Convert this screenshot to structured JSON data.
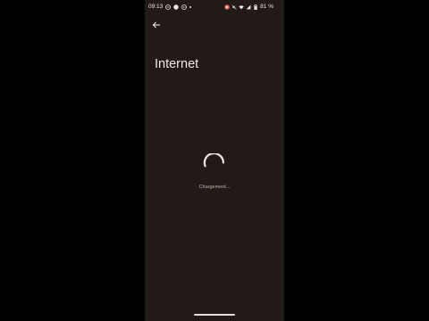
{
  "status_bar": {
    "time": "09:13",
    "battery_percent": "81 %",
    "left_icons": [
      "minus-circle-icon",
      "filled-circle-icon",
      "minus-circle-icon",
      "dot-icon"
    ],
    "right_icons": [
      "screen-record-icon",
      "mute-icon",
      "wifi-icon",
      "signal-icon",
      "battery-icon"
    ]
  },
  "header": {
    "back_icon": "arrow-back-icon",
    "title": "Internet"
  },
  "main": {
    "loading_text": "Chargement..."
  },
  "colors": {
    "background": "#211a16",
    "text": "#f3e8e3",
    "spinner": "#f3e8e3",
    "record_red": "#e2554f"
  }
}
